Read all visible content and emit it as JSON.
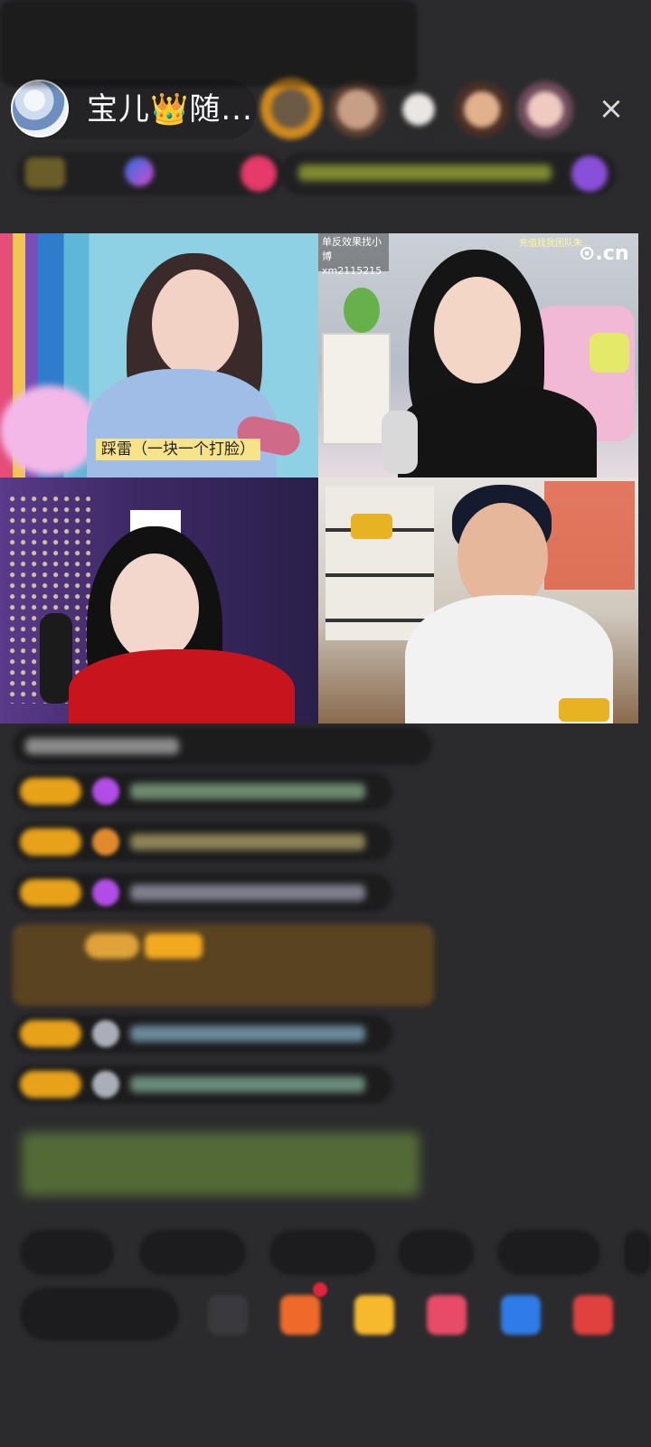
{
  "host": {
    "name": "宝儿",
    "crown": "👑",
    "suffix": "随..."
  },
  "close_label": "×",
  "video": {
    "top_left_caption": "踩雷（一块一个打脸）",
    "top_right_tag_line1": "单反效果找小博",
    "top_right_tag_line2": "xm2115215",
    "top_right_corner": "充值找我团队朱...",
    "top_right_logo": "⊙.cn"
  },
  "icons": {
    "close": "close-icon",
    "crown": "crown-icon"
  },
  "colors": {
    "background": "#2b2b2d",
    "badge_gold": "#e8a21a",
    "caption_bg": "#f8e38a"
  }
}
